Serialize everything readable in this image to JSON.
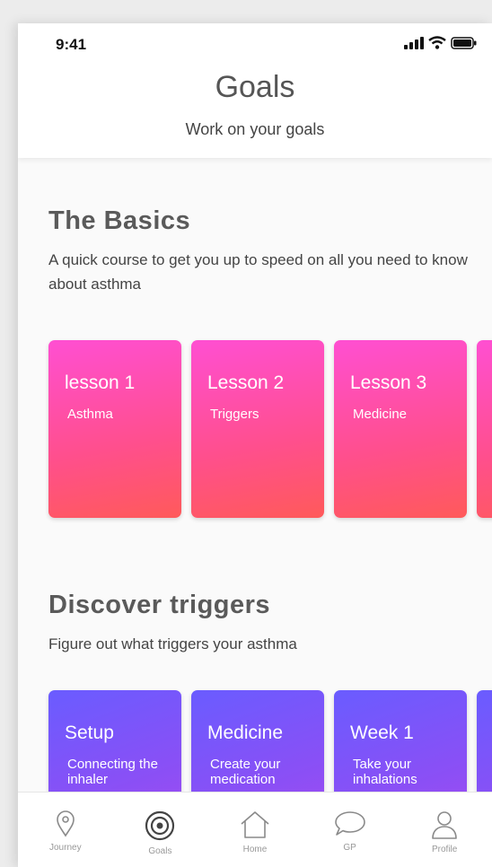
{
  "status": {
    "time": "9:41"
  },
  "header": {
    "title": "Goals",
    "subtitle": "Work on your goals"
  },
  "basics": {
    "title": "The Basics",
    "description": "A quick course to get you up to speed on all you need to know about asthma",
    "cards": [
      {
        "title": "lesson 1",
        "subtitle": "Asthma"
      },
      {
        "title": "Lesson 2",
        "subtitle": "Triggers"
      },
      {
        "title": "Lesson 3",
        "subtitle": "Medicine"
      }
    ]
  },
  "triggers": {
    "title": "Discover triggers",
    "description": "Figure out what triggers your asthma",
    "cards": [
      {
        "title": "Setup",
        "subtitle": "Connecting the inhaler"
      },
      {
        "title": "Medicine",
        "subtitle": "Create your medication"
      },
      {
        "title": "Week 1",
        "subtitle": "Take your inhalations"
      }
    ]
  },
  "tabbar": {
    "items": [
      {
        "label": "Journey",
        "icon": "location-pin-icon"
      },
      {
        "label": "Goals",
        "icon": "target-icon",
        "active": true
      },
      {
        "label": "Home",
        "icon": "home-icon"
      },
      {
        "label": "GP",
        "icon": "chat-bubble-icon"
      },
      {
        "label": "Profile",
        "icon": "person-icon"
      }
    ]
  },
  "colors": {
    "pink_start": "#ff4fd2",
    "pink_end": "#ff5a5a",
    "purple_start": "#6a5cff",
    "purple_end": "#b04cf0",
    "text": "#444444"
  }
}
